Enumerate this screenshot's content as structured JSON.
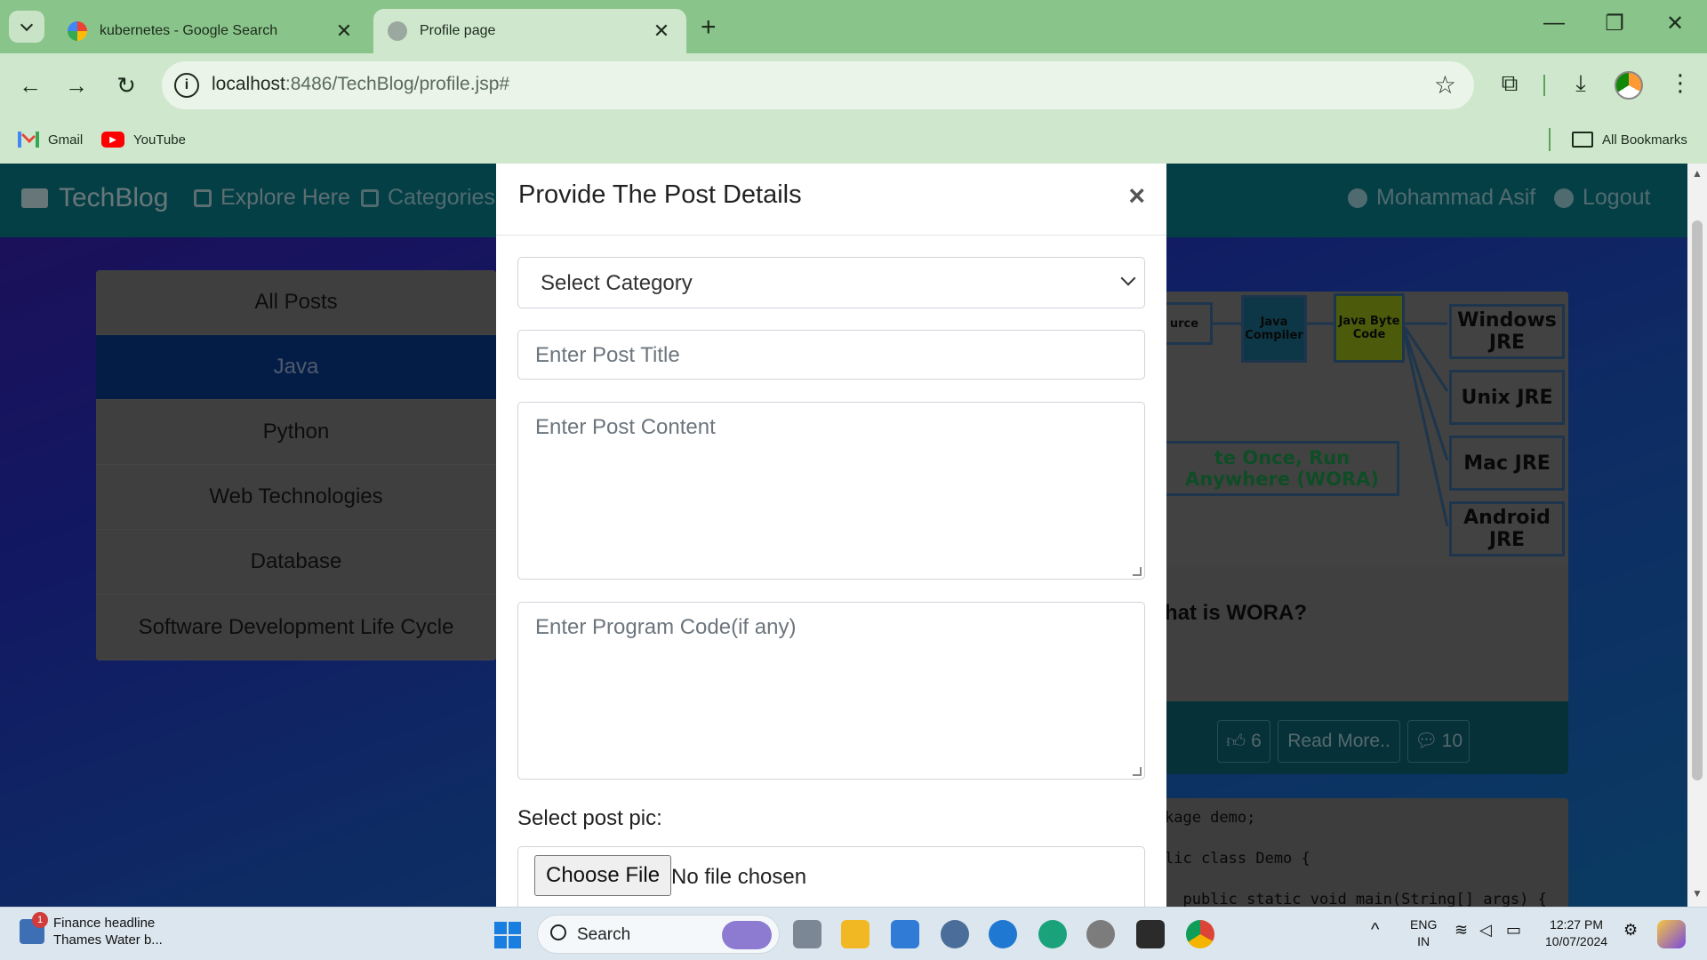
{
  "browser": {
    "tabs": [
      {
        "title": "kubernetes - Google Search"
      },
      {
        "title": "Profile page"
      }
    ],
    "url_host": "localhost",
    "url_rest": ":8486/TechBlog/profile.jsp#",
    "bookmarks": [
      {
        "label": "Gmail"
      },
      {
        "label": "YouTube"
      }
    ],
    "all_bookmarks": "All Bookmarks"
  },
  "site_nav": {
    "brand": "TechBlog",
    "explore": "Explore Here",
    "categories": "Categories",
    "user": "Mohammad Asif",
    "logout": "Logout"
  },
  "categories": [
    {
      "label": "All Posts"
    },
    {
      "label": "Java",
      "active": true
    },
    {
      "label": "Python"
    },
    {
      "label": "Web Technologies"
    },
    {
      "label": "Database"
    },
    {
      "label": "Software Development Life Cycle"
    }
  ],
  "post": {
    "diagram": {
      "source_fragment": "urce",
      "compiler": "Java Compiler",
      "bytecode": "Java Byte Code",
      "targets": [
        "Windows JRE",
        "Unix JRE",
        "Mac JRE",
        "Android JRE"
      ],
      "wora": "te Once, Run Anywhere (WORA)"
    },
    "title_fragment": "hat is WORA?",
    "likes": "6",
    "read_more": "Read More..",
    "comments": "10"
  },
  "code_lines": [
    "kage demo;",
    "lic class Demo {",
    "  public static void main(String[] args) {"
  ],
  "modal": {
    "title": "Provide The Post Details",
    "close": "×",
    "select_category": "Select Category",
    "title_placeholder": "Enter Post Title",
    "content_placeholder": "Enter Post Content",
    "code_placeholder": "Enter Program Code(if any)",
    "pic_label": "Select post pic:",
    "choose_file": "Choose File",
    "file_status": "No file chosen"
  },
  "taskbar": {
    "news_badge": "1",
    "news_title": "Finance headline",
    "news_sub": "Thames Water b...",
    "search": "Search",
    "lang1": "ENG",
    "lang2": "IN",
    "time": "12:27 PM",
    "date": "10/07/2024"
  },
  "colors": {
    "browser_frame": "#89c48a",
    "site_nav": "#0b7e8c",
    "active_category": "#063b8f"
  }
}
